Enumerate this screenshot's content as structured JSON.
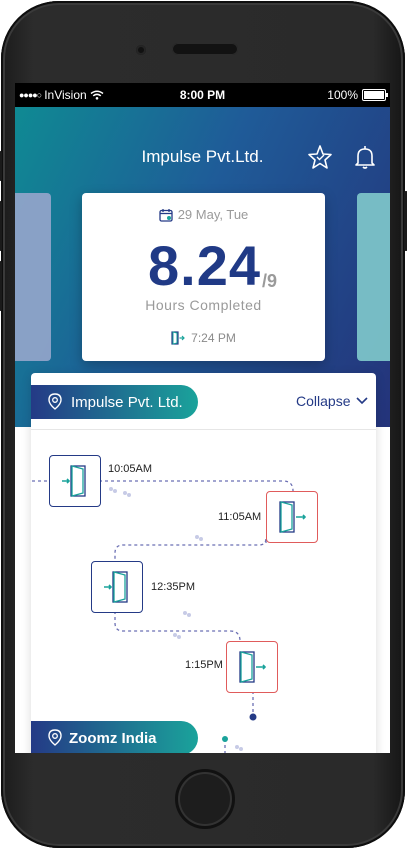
{
  "status_bar": {
    "carrier": "InVision",
    "time": "8:00 PM",
    "battery": "100%"
  },
  "header": {
    "title": "Impulse Pvt.Ltd."
  },
  "summary_card": {
    "date": "29 May, Tue",
    "hours": "8.24",
    "total": "/9",
    "hours_label": "Hours Completed",
    "checkin_time": "7:24 PM"
  },
  "sites": [
    {
      "name": "Impulse Pvt. Ltd.",
      "collapse_label": "Collapse"
    },
    {
      "name": "Zoomz India"
    }
  ],
  "entries": [
    {
      "time": "10:05AM",
      "type": "check-in"
    },
    {
      "time": "11:05AM",
      "type": "check-out"
    },
    {
      "time": "12:35PM",
      "type": "check-in"
    },
    {
      "time": "1:15PM",
      "type": "check-out"
    }
  ],
  "colors": {
    "primary": "#243a86",
    "teal": "#1aa39b",
    "checkout_border": "#e05b5b"
  }
}
